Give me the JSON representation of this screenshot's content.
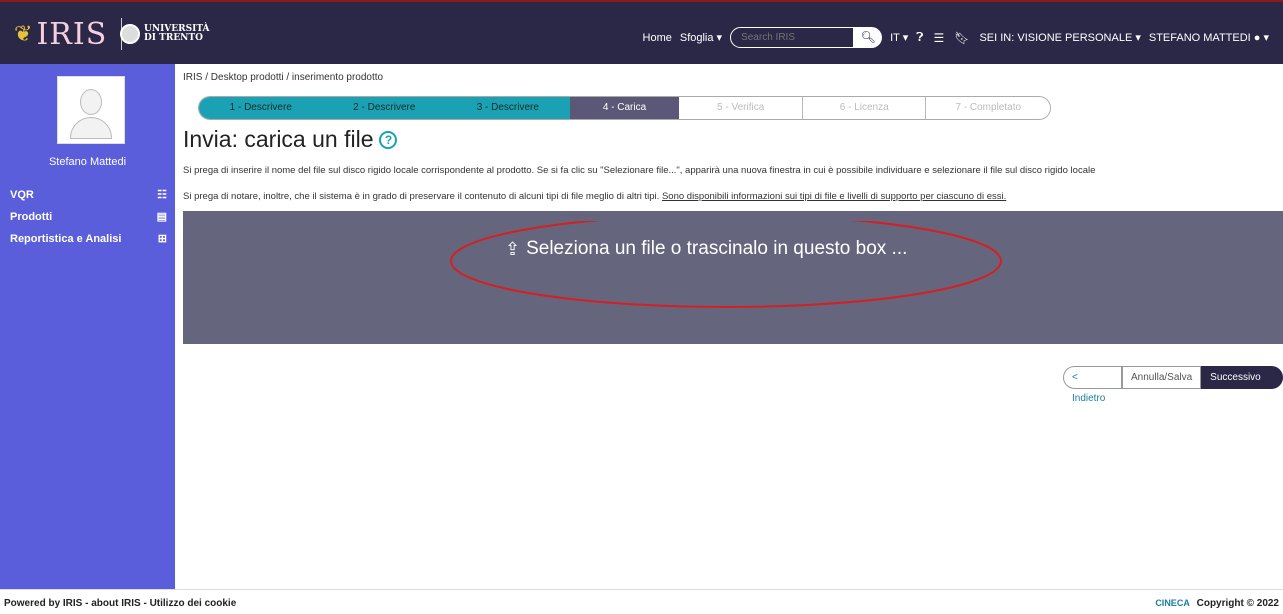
{
  "header": {
    "logo_text": "IRIS",
    "university_line1": "UNIVERSITÀ",
    "university_line2": "DI TRENTO",
    "nav": {
      "home": "Home",
      "sfoglia": "Sfoglia",
      "lang": "IT",
      "view": "SEI IN: VISIONE PERSONALE",
      "user": "STEFANO MATTEDI"
    },
    "search": {
      "placeholder": "Search IRIS"
    }
  },
  "sidebar": {
    "username": "Stefano Mattedi",
    "items": [
      {
        "label": "VQR",
        "icon": "list-icon"
      },
      {
        "label": "Prodotti",
        "icon": "folder-icon"
      },
      {
        "label": "Reportistica e Analisi",
        "icon": "grid-icon"
      }
    ]
  },
  "breadcrumb": "IRIS / Desktop prodotti / inserimento prodotto",
  "steps": [
    "1 - Descrivere",
    "2 - Descrivere",
    "3 - Descrivere",
    "4 - Carica",
    "5 - Verifica",
    "6 - Licenza",
    "7 - Completato"
  ],
  "page": {
    "title": "Invia: carica un file",
    "help": "?",
    "para1": "Si prega di inserire il nome del file sul disco rigido locale corrispondente al prodotto. Se si fa clic su \"Selezionare file...\", apparirà una nuova finestra in cui è possibile individuare e selezionare il file sul disco rigido locale",
    "para2_text": "Si prega di notare, inoltre, che il sistema è in grado di preservare il contenuto di alcuni tipi di file meglio di altri tipi. ",
    "para2_link": "Sono disponibili informazioni sui tipi di file e livelli di supporto per ciascuno di essi.",
    "dropbox_text": "Seleziona un file o trascinalo in questo box ..."
  },
  "buttons": {
    "back": "< Indietro",
    "cancel": "Annulla/Salva",
    "next": "Successivo >"
  },
  "footer": {
    "left": "Powered by IRIS - about IRIS - Utilizzo dei cookie",
    "cineca": "CINECA",
    "right": "Copyright © 2022"
  },
  "colors": {
    "header": "#2a2747",
    "sidebar": "#5b5edb",
    "step_done": "#1aa2b4",
    "dropbox": "#66657e",
    "annotation": "#d42020"
  }
}
